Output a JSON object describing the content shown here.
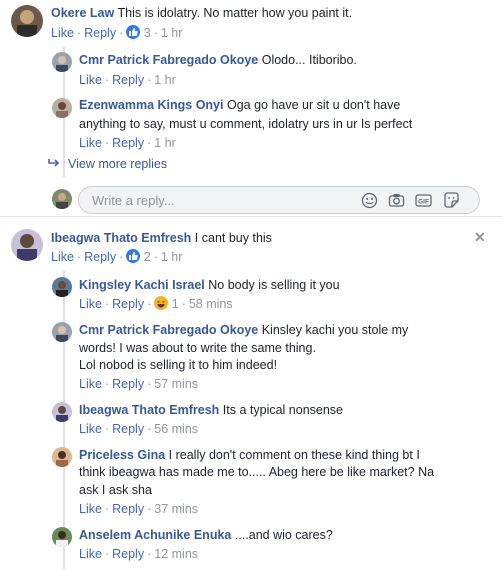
{
  "labels": {
    "like": "Like",
    "reply": "Reply",
    "dot": "·"
  },
  "comment1": {
    "author": "Okere Law",
    "text": "This is idolatry. No matter how you paint it.",
    "reactions": "3",
    "time": "1 hr",
    "replies": [
      {
        "author": "Cmr Patrick Fabregado Okoye",
        "lines": [
          "Olodo... Itiboribo."
        ],
        "time": "1 hr"
      },
      {
        "author": "Ezenwamma Kings Onyi",
        "lines": [
          "Oga go have ur sit u don't have",
          "anything to say, must u comment, idolatry urs in ur Is perfect"
        ],
        "time": "1 hr"
      }
    ],
    "view_more": "View more replies",
    "reply_placeholder": "Write a reply..."
  },
  "comment2": {
    "author": "Ibeagwa Thato Emfresh",
    "text": "I cant buy this",
    "reactions": "2",
    "time": "1 hr",
    "replies": [
      {
        "author": "Kingsley Kachi Israel",
        "lines": [
          "No body is selling it you"
        ],
        "reactions": "1",
        "time": "58 mins"
      },
      {
        "author": "Cmr Patrick Fabregado Okoye",
        "lines": [
          "Kinsley kachi you stole my",
          "words! I was about to write the same thing.",
          "Lol nobod is selling it to him indeed!"
        ],
        "time": "57 mins"
      },
      {
        "author": "Ibeagwa Thato Emfresh",
        "lines": [
          "Its a typical nonsense"
        ],
        "time": "56 mins"
      },
      {
        "author": "Priceless Gina",
        "lines": [
          "I really don't comment on these kind thing bt I",
          "think ibeagwa has made me to..... Abeg here be like market? Na",
          "ask I ask sha"
        ],
        "time": "37 mins"
      },
      {
        "author": "Anselem Achunike Enuka",
        "lines": [
          "....and wio cares?"
        ],
        "time": "12 mins"
      }
    ]
  },
  "icons": {
    "emoji": "smiley-icon",
    "camera": "camera-icon",
    "gif": "gif-icon",
    "sticker": "sticker-icon",
    "close": "close-icon",
    "reply_arrow": "reply-arrow-icon"
  },
  "colors": {
    "link": "#385898",
    "meta": "#90949c",
    "like_blue": "#3578e5",
    "haha_yellow": "#f7b125"
  }
}
